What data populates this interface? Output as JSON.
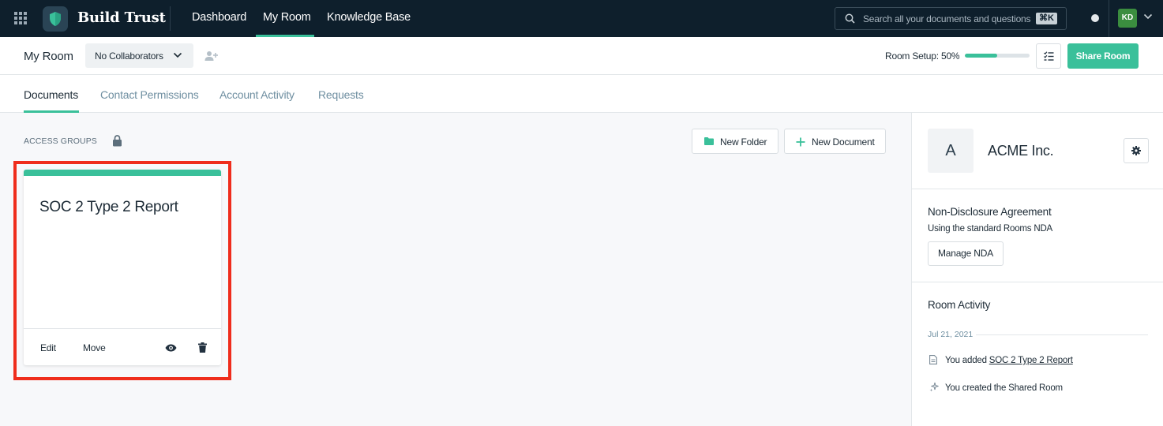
{
  "topnav": {
    "brand": "Build Trust",
    "links": [
      {
        "label": "Dashboard"
      },
      {
        "label": "My Room"
      },
      {
        "label": "Knowledge Base"
      }
    ],
    "active_link": "My Room",
    "search_placeholder": "Search all your documents and questions",
    "search_shortcut": "⌘K",
    "user_initials": "KD"
  },
  "subheader": {
    "title": "My Room",
    "collaborators_label": "No Collaborators",
    "room_setup_label": "Room Setup: 50%",
    "room_setup_progress": 0.5,
    "share_label": "Share Room"
  },
  "tabs": [
    {
      "label": "Documents",
      "active": true
    },
    {
      "label": "Contact Permissions",
      "active": false
    },
    {
      "label": "Account Activity",
      "active": false
    },
    {
      "label": "Requests",
      "active": false
    }
  ],
  "main": {
    "access_groups_label": "ACCESS GROUPS",
    "new_folder_label": "New Folder",
    "new_document_label": "New Document",
    "document_card": {
      "title": "SOC 2 Type 2 Report",
      "edit_label": "Edit",
      "move_label": "Move"
    }
  },
  "right_panel": {
    "org_initial": "A",
    "org_name": "ACME Inc.",
    "nda": {
      "heading": "Non-Disclosure Agreement",
      "description": "Using the standard Rooms NDA",
      "button_label": "Manage NDA"
    },
    "activity": {
      "heading": "Room Activity",
      "date": "Jul 21, 2021",
      "items": [
        {
          "prefix": "You added ",
          "link": "SOC 2 Type 2 Report"
        },
        {
          "prefix": "You created the Shared Room",
          "link": ""
        }
      ]
    }
  },
  "colors": {
    "nav_bg": "#0e1f2c",
    "accent": "#3ac09a",
    "highlight": "#ef2d1c",
    "avatar_bg": "#3b8d3f"
  }
}
